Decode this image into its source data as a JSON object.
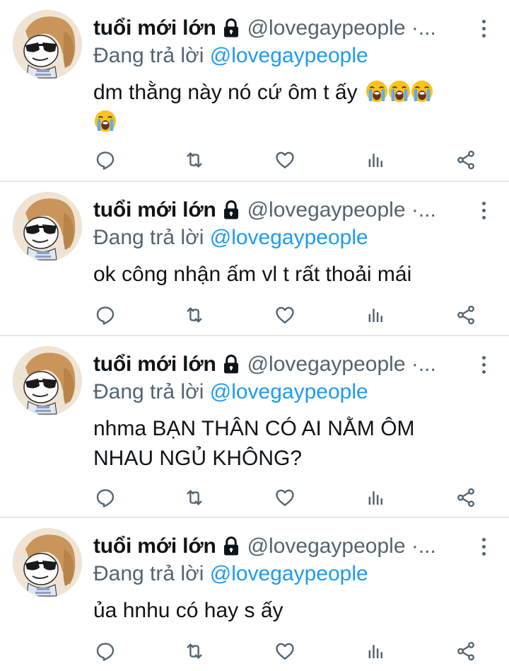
{
  "colors": {
    "text": "#0f1419",
    "secondary": "#536471",
    "mention": "#1d9bf0",
    "divider": "#e6e9ec"
  },
  "tweets": [
    {
      "display_name": "tuổi mới lớn",
      "handle": "@lovegaypeople ·...",
      "reply_prefix": "Đang trả lời",
      "reply_mention": "@lovegaypeople",
      "text_line1": "dm thằng này nó cứ ôm t ấy",
      "emoji": "loudly-crying-face"
    },
    {
      "display_name": "tuổi mới lớn",
      "handle": "@lovegaypeople ·...",
      "reply_prefix": "Đang trả lời",
      "reply_mention": "@lovegaypeople",
      "text_line1": "ok công nhận ấm vl t rất thoải mái"
    },
    {
      "display_name": "tuổi mới lớn",
      "handle": "@lovegaypeople ·...",
      "reply_prefix": "Đang trả lời",
      "reply_mention": "@lovegaypeople",
      "text_line1": "nhma BẠN THÂN CÓ AI NẰM ÔM",
      "text_line2": "NHAU NGỦ KHÔNG?"
    },
    {
      "display_name": "tuổi mới lớn",
      "handle": "@lovegaypeople ·...",
      "reply_prefix": "Đang trả lời",
      "reply_mention": "@lovegaypeople",
      "text_line1": "ủa hnhu có hay s ấy"
    }
  ],
  "icons": {
    "lock": "lock-icon",
    "more": "more-options-icon",
    "reply": "reply-icon",
    "retweet": "retweet-icon",
    "like": "heart-icon",
    "analytics": "analytics-icon",
    "share": "share-icon"
  }
}
